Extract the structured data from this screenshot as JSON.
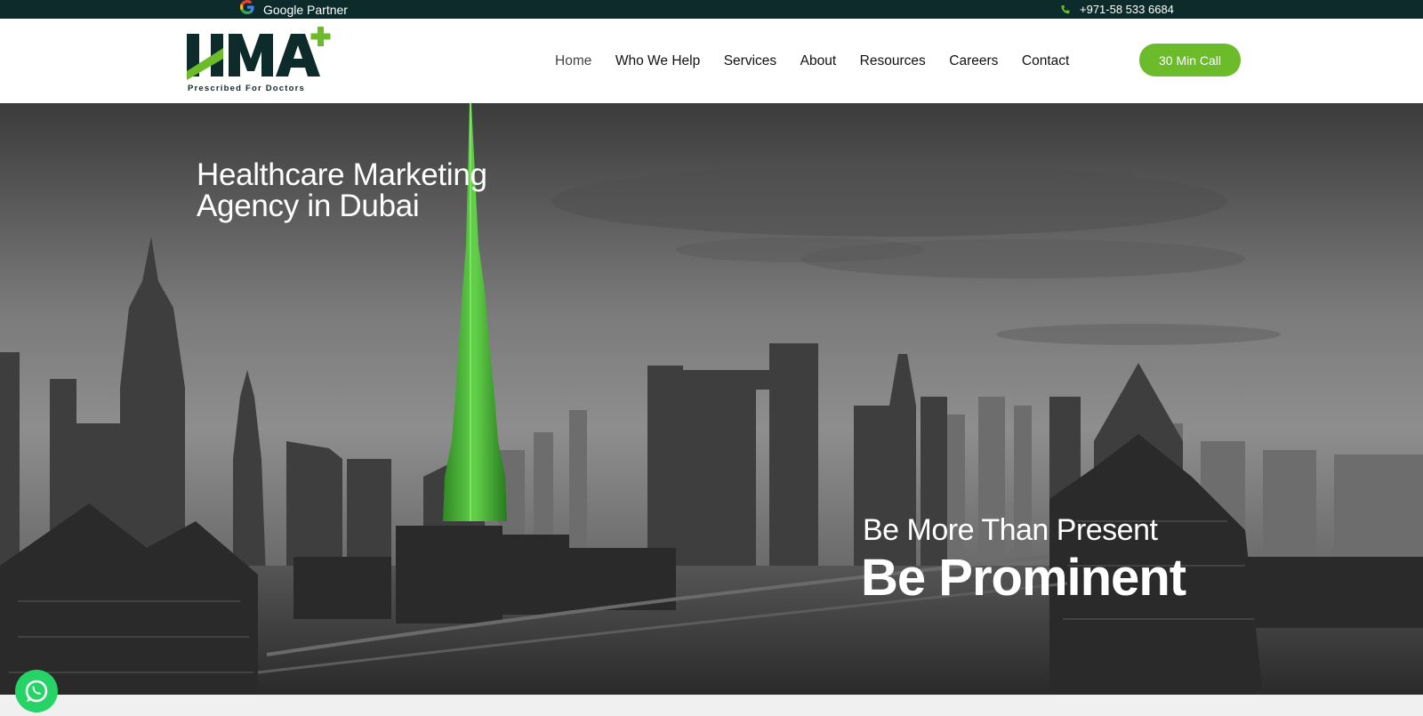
{
  "topbar": {
    "partner_label": "Google Partner",
    "phone": "+971-58 533 6684"
  },
  "brand": {
    "logo_text": "HMA",
    "tagline": "Prescribed For Doctors"
  },
  "nav": {
    "items": [
      {
        "label": "Home",
        "active": true
      },
      {
        "label": "Who We Help"
      },
      {
        "label": "Services"
      },
      {
        "label": "About"
      },
      {
        "label": "Resources"
      },
      {
        "label": "Careers"
      },
      {
        "label": "Contact"
      }
    ],
    "cta_label": "30 Min Call"
  },
  "hero": {
    "title_line1": "Healthcare Marketing",
    "title_line2": "Agency in Dubai",
    "slogan_line1": "Be More Than Present",
    "slogan_line2": "Be Prominent"
  },
  "icons": {
    "google": "google-icon",
    "phone": "phone-icon",
    "whatsapp": "whatsapp-icon",
    "plus": "plus-icon"
  },
  "colors": {
    "topbar_bg": "#0d2b2b",
    "accent_green": "#6cbb2a",
    "brand_dark": "#0d2b2b",
    "whatsapp_green": "#25d366"
  }
}
